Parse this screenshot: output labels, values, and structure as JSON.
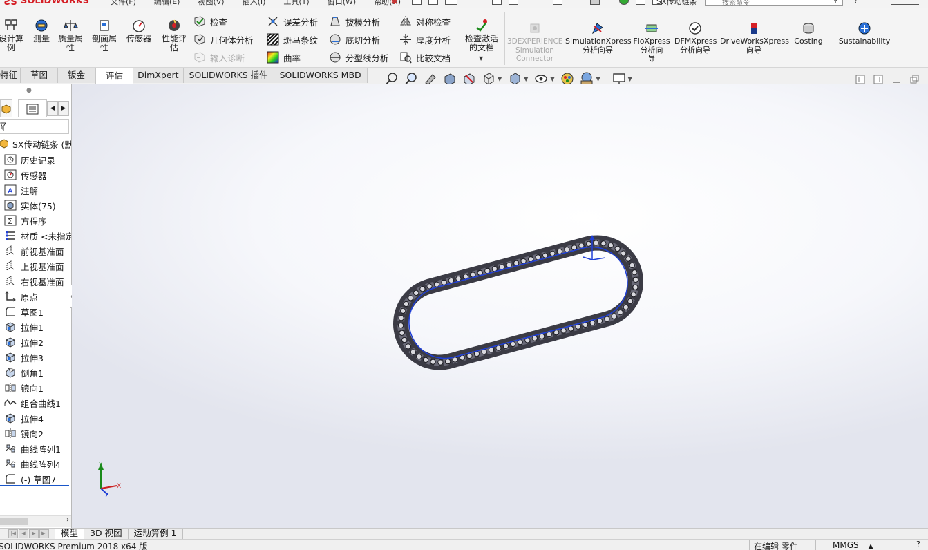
{
  "app": {
    "logo_text": "SOLIDWORKS",
    "menus": [
      "文件(F)",
      "编辑(E)",
      "视图(V)",
      "插入(I)",
      "工具(T)",
      "窗口(W)",
      "帮助(H)"
    ],
    "document_title": "SX传动链条",
    "search_placeholder": "搜索命令"
  },
  "ribbon": {
    "big_buttons": [
      {
        "id": "design-study",
        "label": "设计算\n例"
      },
      {
        "id": "measure",
        "label": "测量"
      },
      {
        "id": "mass-properties",
        "label": "质量属\n性"
      },
      {
        "id": "section-properties",
        "label": "剖面属\n性"
      },
      {
        "id": "sensor",
        "label": "传感器"
      },
      {
        "id": "performance-evaluation",
        "label": "性能评\n估"
      }
    ],
    "group1": [
      {
        "id": "check",
        "label": "检查"
      },
      {
        "id": "geometry-analysis",
        "label": "几何体分析"
      },
      {
        "id": "import-diagnostics",
        "label": "输入诊断",
        "disabled": true
      }
    ],
    "group2": [
      {
        "id": "deviation-analysis",
        "label": "误差分析"
      },
      {
        "id": "zebra-stripes",
        "label": "斑马条纹"
      },
      {
        "id": "curvature",
        "label": "曲率"
      }
    ],
    "group3": [
      {
        "id": "draft-analysis",
        "label": "拔模分析"
      },
      {
        "id": "undercut-analysis",
        "label": "底切分析"
      },
      {
        "id": "parting-line-analysis",
        "label": "分型线分析"
      }
    ],
    "group4": [
      {
        "id": "symmetry-check",
        "label": "对称检查"
      },
      {
        "id": "thickness-analysis",
        "label": "厚度分析"
      },
      {
        "id": "compare-documents",
        "label": "比较文档"
      }
    ],
    "check_active_doc": "检查激活\n的文档",
    "addins": [
      {
        "id": "3dexperience",
        "label": "3DEXPERIENCE\nSimulation\nConnector",
        "disabled": true
      },
      {
        "id": "simulationxpress",
        "label": "SimulationXpress\n分析向导"
      },
      {
        "id": "floxpress",
        "label": "FloXpress\n分析向\n导"
      },
      {
        "id": "dfmxpress",
        "label": "DFMXpress\n分析向导"
      },
      {
        "id": "driveworksxpress",
        "label": "DriveWorksXpress\n向导"
      },
      {
        "id": "costing",
        "label": "Costing"
      },
      {
        "id": "sustainability",
        "label": "Sustainability"
      }
    ]
  },
  "command_tabs": [
    {
      "label": "特征",
      "active": false
    },
    {
      "label": "草图",
      "active": false
    },
    {
      "label": "钣金",
      "active": false
    },
    {
      "label": "评估",
      "active": true
    },
    {
      "label": "DimXpert",
      "active": false
    },
    {
      "label": "SOLIDWORKS 插件",
      "active": false
    },
    {
      "label": "SOLIDWORKS MBD",
      "active": false
    }
  ],
  "feature_tree": {
    "root": "SX传动链条 (默认",
    "items": [
      {
        "label": "历史记录",
        "icon": "history-icon"
      },
      {
        "label": "传感器",
        "icon": "sensor-icon"
      },
      {
        "label": "注解",
        "icon": "annotation-icon"
      },
      {
        "label": "实体(75)",
        "icon": "solid-bodies-icon"
      },
      {
        "label": "方程序",
        "icon": "equations-icon"
      },
      {
        "label": "材质 <未指定>",
        "icon": "material-icon"
      },
      {
        "label": "前视基准面",
        "icon": "plane-icon"
      },
      {
        "label": "上视基准面",
        "icon": "plane-icon"
      },
      {
        "label": "右视基准面",
        "icon": "plane-icon"
      },
      {
        "label": "原点",
        "icon": "origin-icon"
      },
      {
        "label": "草图1",
        "icon": "sketch-icon"
      },
      {
        "label": "拉伸1",
        "icon": "extrude-icon"
      },
      {
        "label": "拉伸2",
        "icon": "extrude-icon"
      },
      {
        "label": "拉伸3",
        "icon": "extrude-icon"
      },
      {
        "label": "倒角1",
        "icon": "chamfer-icon"
      },
      {
        "label": "镜向1",
        "icon": "mirror-icon"
      },
      {
        "label": "组合曲线1",
        "icon": "composite-curve-icon"
      },
      {
        "label": "拉伸4",
        "icon": "extrude-icon"
      },
      {
        "label": "镜向2",
        "icon": "mirror-icon"
      },
      {
        "label": "曲线阵列1",
        "icon": "curve-pattern-icon"
      },
      {
        "label": "曲线阵列4",
        "icon": "curve-pattern-icon"
      },
      {
        "label": "(-) 草图7",
        "icon": "sketch-icon"
      }
    ]
  },
  "bottom_tabs": [
    {
      "label": "模型",
      "active": true
    },
    {
      "label": "3D 视图",
      "active": false
    },
    {
      "label": "运动算例 1",
      "active": false
    }
  ],
  "status": {
    "product": "SOLIDWORKS Premium 2018 x64 版",
    "edit_mode": "在编辑 零件",
    "units": "MMGS"
  },
  "triad": {
    "x": "X",
    "y": "Y",
    "z": "Z"
  },
  "colors": {
    "brand_red": "#d51f26",
    "chain_dark": "#3b3b45",
    "chain_path": "#1f3fd6",
    "active_tab_bg": "#ffffff"
  }
}
